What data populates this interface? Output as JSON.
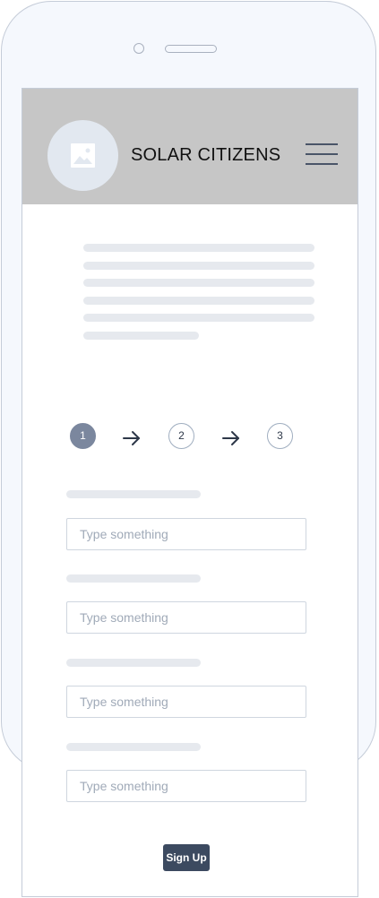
{
  "device": {
    "frame": "phone"
  },
  "header": {
    "logo_icon": "image-placeholder-icon",
    "brand": "SOLAR CITIZENS",
    "menu_icon": "hamburger-menu-icon",
    "background": "#c6c6c6"
  },
  "intro": {
    "placeholder_line_count": 6
  },
  "stepper": {
    "steps": [
      {
        "number": "1",
        "state": "active"
      },
      {
        "number": "2",
        "state": "inactive"
      },
      {
        "number": "3",
        "state": "inactive"
      }
    ],
    "separator_icon": "arrow-right-icon",
    "active_color": "#7b879e"
  },
  "form": {
    "fields": [
      {
        "value": "",
        "placeholder": "Type something"
      },
      {
        "value": "",
        "placeholder": "Type something"
      },
      {
        "value": "",
        "placeholder": "Type something"
      },
      {
        "value": "",
        "placeholder": "Type something"
      }
    ],
    "submit_label": "Sign Up",
    "submit_color": "#3c4a60"
  }
}
